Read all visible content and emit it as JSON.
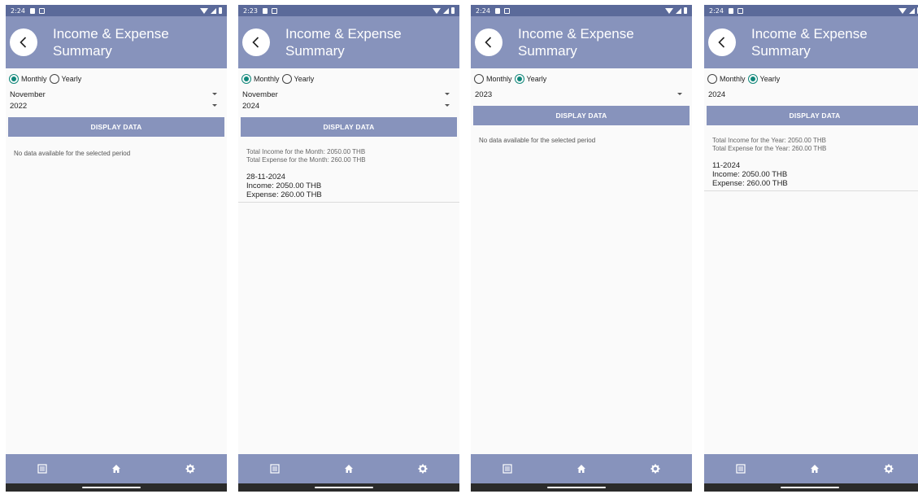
{
  "app": {
    "title": "Income & Expense Summary"
  },
  "radio_labels": {
    "monthly": "Monthly",
    "yearly": "Yearly"
  },
  "button_label": "DISPLAY DATA",
  "screens": [
    {
      "status_time": "2:24",
      "mode": "monthly",
      "month": "November",
      "year": "2022",
      "no_data_message": "No data available for the selected period"
    },
    {
      "status_time": "2:23",
      "mode": "monthly",
      "month": "November",
      "year": "2024",
      "total_income": "Total Income for the Month: 2050.00 THB",
      "total_expense": "Total Expense for the Month: 260.00 THB",
      "entry_date": "28-11-2024",
      "entry_income": "Income: 2050.00 THB",
      "entry_expense": "Expense: 260.00 THB"
    },
    {
      "status_time": "2:24",
      "mode": "yearly",
      "year": "2023",
      "no_data_message": "No data available for the selected period"
    },
    {
      "status_time": "2:24",
      "mode": "yearly",
      "year": "2024",
      "total_income": "Total Income for the Year: 2050.00 THB",
      "total_expense": "Total Expense for the Year: 260.00 THB",
      "entry_date": "11-2024",
      "entry_income": "Income: 2050.00 THB",
      "entry_expense": "Expense: 260.00 THB"
    }
  ],
  "nav_icons": [
    "list-icon",
    "home-icon",
    "gear-icon"
  ],
  "colors": {
    "primary": "#8793bc",
    "status_bar": "#5b6a9a",
    "radio_checked": "#10877a"
  }
}
